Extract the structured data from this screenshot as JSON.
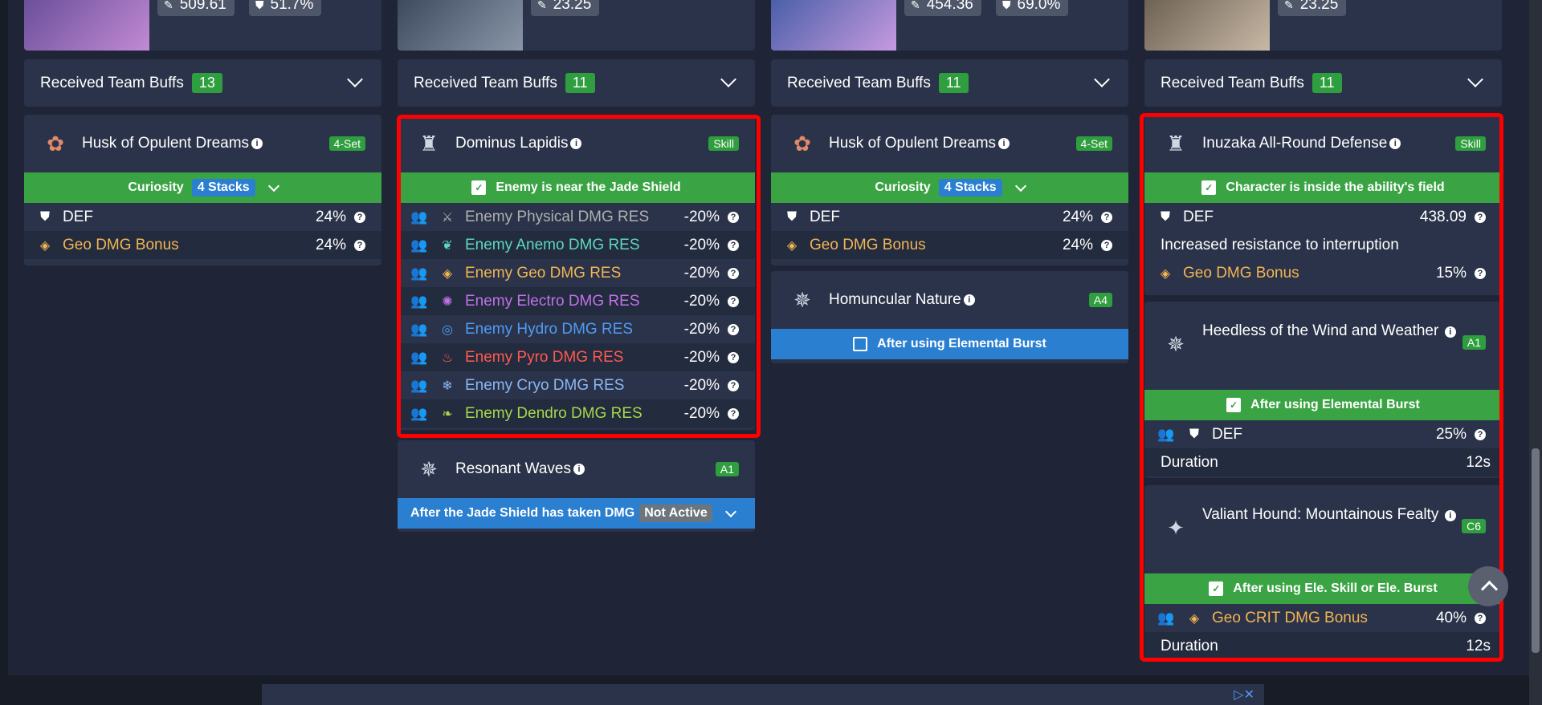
{
  "colors": {
    "geo": "#f2b552",
    "anemo": "#5dd8bd",
    "electro": "#c072e8",
    "hydro": "#4f9cf5",
    "pyro": "#ff5a4e",
    "cryo": "#8ab8f5",
    "dendro": "#a5d84b",
    "physical": "#b0b0b0",
    "green": "#3aa444",
    "blue": "#2b7fd1"
  },
  "columns": [
    {
      "stats": [
        "509.61",
        "51.7%"
      ],
      "buffs_label": "Received Team Buffs",
      "buffs_count": "13",
      "panel1": {
        "title": "Husk of Opulent Dreams",
        "tag": "4-Set",
        "cond_label": "Curiosity",
        "cond_stacks": "4 Stacks",
        "rows": [
          {
            "name": "DEF",
            "val": "24%"
          },
          {
            "name": "Geo DMG Bonus",
            "val": "24%"
          }
        ]
      }
    },
    {
      "stats": [
        "23.25"
      ],
      "buffs_label": "Received Team Buffs",
      "buffs_count": "11",
      "panel1": {
        "title": "Dominus Lapidis",
        "tag": "Skill",
        "cond": "Enemy is near the Jade Shield",
        "rows": [
          {
            "name": "Enemy Physical DMG RES",
            "val": "-20%"
          },
          {
            "name": "Enemy Anemo DMG RES",
            "val": "-20%"
          },
          {
            "name": "Enemy Geo DMG RES",
            "val": "-20%"
          },
          {
            "name": "Enemy Electro DMG RES",
            "val": "-20%"
          },
          {
            "name": "Enemy Hydro DMG RES",
            "val": "-20%"
          },
          {
            "name": "Enemy Pyro DMG RES",
            "val": "-20%"
          },
          {
            "name": "Enemy Cryo DMG RES",
            "val": "-20%"
          },
          {
            "name": "Enemy Dendro DMG RES",
            "val": "-20%"
          }
        ]
      },
      "panel2": {
        "title": "Resonant Waves",
        "tag": "A1",
        "cond": "After the Jade Shield has taken DMG",
        "cond_state": "Not Active"
      }
    },
    {
      "stats": [
        "454.36",
        "69.0%"
      ],
      "buffs_label": "Received Team Buffs",
      "buffs_count": "11",
      "panel1": {
        "title": "Husk of Opulent Dreams",
        "tag": "4-Set",
        "cond_label": "Curiosity",
        "cond_stacks": "4 Stacks",
        "rows": [
          {
            "name": "DEF",
            "val": "24%"
          },
          {
            "name": "Geo DMG Bonus",
            "val": "24%"
          }
        ]
      },
      "panel2": {
        "title": "Homuncular Nature",
        "tag": "A4",
        "cond": "After using Elemental Burst"
      }
    },
    {
      "stats": [
        "23.25"
      ],
      "buffs_label": "Received Team Buffs",
      "buffs_count": "11",
      "panel1": {
        "title": "Inuzaka All-Round Defense",
        "tag": "Skill",
        "cond": "Character is inside the ability's field",
        "rows": [
          {
            "name": "DEF",
            "val": "438.09"
          },
          {
            "name": "Increased resistance to interruption",
            "val": ""
          },
          {
            "name": "Geo DMG Bonus",
            "val": "15%"
          }
        ]
      },
      "panel2": {
        "title": "Heedless of the Wind and Weather",
        "tag": "A1",
        "cond": "After using Elemental Burst",
        "rows": [
          {
            "name": "DEF",
            "val": "25%"
          },
          {
            "name": "Duration",
            "val": "12s"
          }
        ]
      },
      "panel3": {
        "title": "Valiant Hound: Mountainous Fealty",
        "tag": "C6",
        "cond": "After using Ele. Skill or Ele. Burst",
        "rows": [
          {
            "name": "Geo CRIT DMG Bonus",
            "val": "40%"
          },
          {
            "name": "Duration",
            "val": "12s"
          }
        ]
      }
    }
  ]
}
